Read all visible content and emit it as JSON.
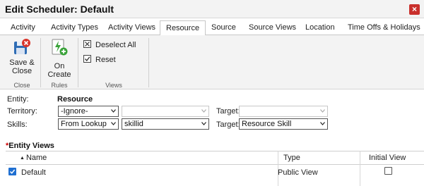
{
  "window": {
    "title": "Edit Scheduler: Default",
    "close_glyph": "×"
  },
  "tabs": [
    {
      "label": "Activity"
    },
    {
      "label": "Activity Types"
    },
    {
      "label": "Activity Views"
    },
    {
      "label": "Resource",
      "active": true
    },
    {
      "label": "Source"
    },
    {
      "label": "Source Views"
    },
    {
      "label": "Location"
    },
    {
      "label": "Time Offs & Holidays"
    }
  ],
  "ribbon": {
    "save_close": {
      "line1": "Save &",
      "line2": "Close",
      "icon": "save-close-icon"
    },
    "on_create": {
      "label": "On Create",
      "icon": "on-create-icon"
    },
    "deselect_all": {
      "label": "Deselect All",
      "icon": "deselect-all-icon"
    },
    "reset": {
      "label": "Reset",
      "icon": "reset-icon"
    },
    "groups": {
      "close": "Close",
      "rules": "Rules",
      "views": "Views"
    }
  },
  "form": {
    "entity_label": "Entity:",
    "entity_value": "Resource",
    "territory_label": "Territory:",
    "territory_value": "-Ignore-",
    "territory_second_value": "",
    "territory_target_label": "Target:",
    "territory_target_value": "",
    "skills_label": "Skills:",
    "skills_value": "From Lookup",
    "skills_field_value": "skillid",
    "skills_target_label": "Target:",
    "skills_target_value": "Resource Skill"
  },
  "entity_views": {
    "required_mark": "*",
    "title": "Entity Views",
    "sort_glyph": "▲",
    "columns": {
      "name": "Name",
      "type": "Type",
      "initial_view": "Initial View"
    },
    "rows": [
      {
        "name": "Default",
        "type": "Public View",
        "selected": true,
        "initial_view": false
      }
    ]
  },
  "colors": {
    "accent": "#1f6fd1",
    "close_red": "#c9302c",
    "required_red": "#cc0000"
  }
}
